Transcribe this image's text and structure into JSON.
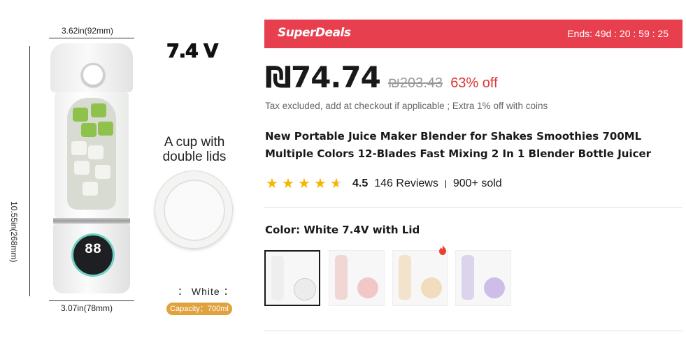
{
  "image": {
    "dim_width_top": "3.62in(92mm)",
    "dim_height_side": "10.55in(268mm)",
    "dim_width_bottom": "3.07in(78mm)",
    "voltage": "7.4 V",
    "cup_label": "A cup with double lids",
    "color_label": "： White ：",
    "capacity": "Capacity：700ml",
    "display_value": "88"
  },
  "deal": {
    "title": "SuperDeals",
    "ends": "Ends: 49d : 20 : 59 : 25"
  },
  "price": {
    "current": "₪74.74",
    "original": "₪203.43",
    "discount": "63% off"
  },
  "tax_note": "Tax excluded, add at checkout if applicable ; Extra 1% off with coins",
  "title": "New Portable Juice Maker Blender for Shakes Smoothies 700ML Multiple Colors 12-Blades Fast Mixing 2 In 1 Blender Bottle Juicer",
  "rating": {
    "stars": 4.5,
    "value": "4.5",
    "reviews": "146 Reviews",
    "sold": "900+ sold"
  },
  "color": {
    "label": "Color: White 7.4V with Lid",
    "options": [
      {
        "name": "White",
        "cup": "#eeeeee",
        "lid": "#ececec",
        "selected": true
      },
      {
        "name": "Pink",
        "cup": "#f1d7d4",
        "lid": "#f2c7c7",
        "selected": false
      },
      {
        "name": "Apricot",
        "cup": "#f3e3cc",
        "lid": "#f1dcbd",
        "selected": false
      },
      {
        "name": "Purple",
        "cup": "#dcd3ec",
        "lid": "#cdbde8",
        "selected": false
      }
    ]
  },
  "colors": {
    "deal_bar": "#e83f4f",
    "discount": "#dd3333",
    "star": "#f5b800",
    "capacity_badge": "#e0a23f"
  }
}
